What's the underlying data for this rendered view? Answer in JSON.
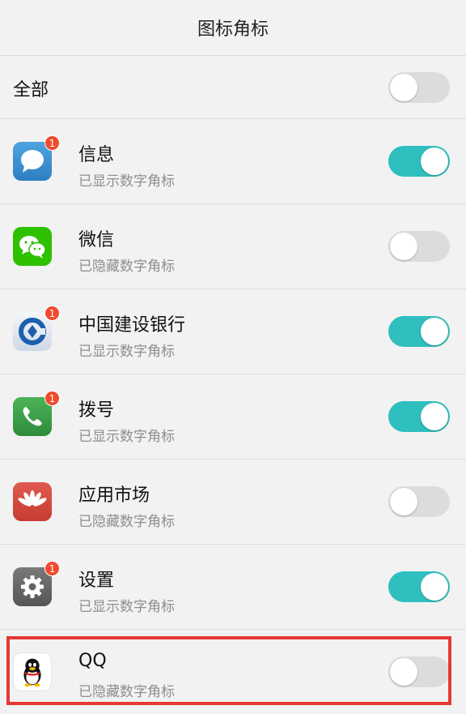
{
  "header": {
    "title": "图标角标"
  },
  "all": {
    "label": "全部",
    "enabled": false
  },
  "apps": [
    {
      "name": "信息",
      "status": "已显示数字角标",
      "enabled": true,
      "badge": "1",
      "icon": "message-icon",
      "color": "#3a8fd1"
    },
    {
      "name": "微信",
      "status": "已隐藏数字角标",
      "enabled": false,
      "badge": "",
      "icon": "wechat-icon",
      "color": "#1aad19"
    },
    {
      "name": "中国建设银行",
      "status": "已显示数字角标",
      "enabled": true,
      "badge": "1",
      "icon": "ccb-icon",
      "color": "#1d5fae"
    },
    {
      "name": "拨号",
      "status": "已显示数字角标",
      "enabled": true,
      "badge": "1",
      "icon": "phone-icon",
      "color": "#3aa047"
    },
    {
      "name": "应用市场",
      "status": "已隐藏数字角标",
      "enabled": false,
      "badge": "",
      "icon": "huawei-appgallery-icon",
      "color": "#d9473f"
    },
    {
      "name": "设置",
      "status": "已显示数字角标",
      "enabled": true,
      "badge": "1",
      "icon": "gear-icon",
      "color": "#6b6b6b"
    },
    {
      "name": "QQ",
      "status": "已隐藏数字角标",
      "enabled": false,
      "badge": "",
      "icon": "qq-penguin-icon",
      "color": "#000000"
    }
  ],
  "colors": {
    "toggle_on": "#2fbfbf",
    "toggle_off": "#dcdcdc",
    "badge": "#f04b2d",
    "highlight": "#e53935"
  }
}
